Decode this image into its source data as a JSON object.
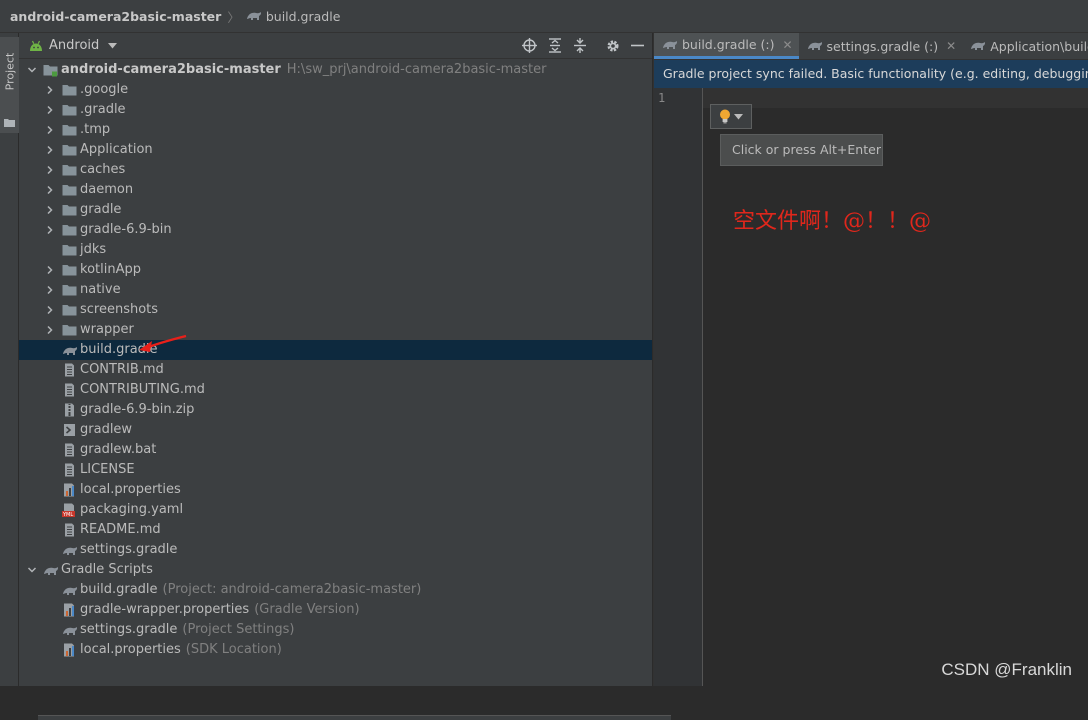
{
  "breadcrumb": {
    "project": "android-camera2basic-master",
    "file": "build.gradle"
  },
  "side_tab": {
    "label": "Project"
  },
  "project_view": {
    "view_name": "Android",
    "toolbar_icons": [
      "locate-icon",
      "expand-all-icon",
      "collapse-all-icon",
      "gear-icon",
      "minimize-icon"
    ]
  },
  "tree": {
    "root": {
      "label": "android-camera2basic-master",
      "path": "H:\\sw_prj\\android-camera2basic-master"
    },
    "folders": [
      ".google",
      ".gradle",
      ".tmp",
      "Application",
      "caches",
      "daemon",
      "gradle",
      "gradle-6.9-bin",
      "jdks",
      "kotlinApp",
      "native",
      "screenshots",
      "wrapper"
    ],
    "files": [
      {
        "label": "build.gradle",
        "icon": "gradle-icon"
      },
      {
        "label": "CONTRIB.md",
        "icon": "markdown-file-icon"
      },
      {
        "label": "CONTRIBUTING.md",
        "icon": "markdown-file-icon"
      },
      {
        "label": "gradle-6.9-bin.zip",
        "icon": "zip-file-icon"
      },
      {
        "label": "gradlew",
        "icon": "shell-script-icon"
      },
      {
        "label": "gradlew.bat",
        "icon": "text-file-icon"
      },
      {
        "label": "LICENSE",
        "icon": "text-file-icon"
      },
      {
        "label": "local.properties",
        "icon": "properties-file-icon"
      },
      {
        "label": "packaging.yaml",
        "icon": "yaml-file-icon",
        "badge": "YML"
      },
      {
        "label": "README.md",
        "icon": "markdown-file-icon"
      },
      {
        "label": "settings.gradle",
        "icon": "gradle-icon"
      }
    ],
    "scripts_group": {
      "label": "Gradle Scripts"
    },
    "scripts": [
      {
        "label": "build.gradle",
        "hint": "(Project: android-camera2basic-master)",
        "icon": "gradle-icon"
      },
      {
        "label": "gradle-wrapper.properties",
        "hint": "(Gradle Version)",
        "icon": "properties-file-icon"
      },
      {
        "label": "settings.gradle",
        "hint": "(Project Settings)",
        "icon": "gradle-icon"
      },
      {
        "label": "local.properties",
        "hint": "(SDK Location)",
        "icon": "properties-file-icon"
      }
    ]
  },
  "editor": {
    "tabs": [
      {
        "label": "build.gradle (:)",
        "active": true
      },
      {
        "label": "settings.gradle (:)",
        "active": false
      },
      {
        "label": "Application\\build.gra",
        "active": false
      }
    ],
    "banner": "Gradle project sync failed. Basic functionality (e.g. editing, debugging) will not work properly.",
    "line_number": "1",
    "tooltip": "Click or press Alt+Enter",
    "annotation": "空文件啊！@！！@"
  },
  "watermark": "CSDN @Franklin",
  "colors": {
    "selection": "#0d293e",
    "banner": "#1d3d5b",
    "folder": "#87939a",
    "annotation": "#e0271c",
    "tab_accent": "#4a88c7"
  }
}
